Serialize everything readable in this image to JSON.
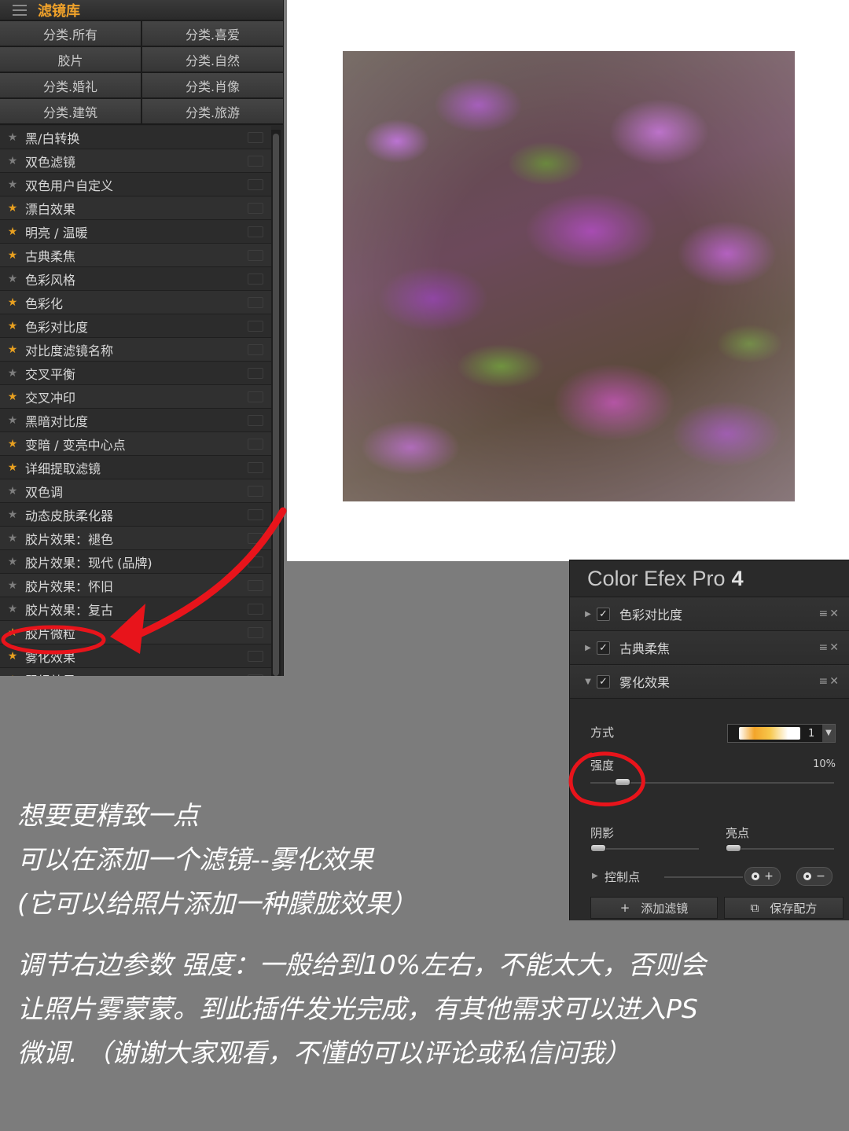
{
  "library": {
    "title": "滤镜库",
    "categories": [
      "分类.所有",
      "分类.喜爱",
      "胶片",
      "分类.自然",
      "分类.婚礼",
      "分类.肖像",
      "分类.建筑",
      "分类.旅游"
    ],
    "filters": [
      {
        "name": "黑/白转换",
        "favorite": false
      },
      {
        "name": "双色滤镜",
        "favorite": false
      },
      {
        "name": "双色用户自定义",
        "favorite": false
      },
      {
        "name": "漂白效果",
        "favorite": true
      },
      {
        "name": "明亮 / 温暖",
        "favorite": true
      },
      {
        "name": "古典柔焦",
        "favorite": true
      },
      {
        "name": "色彩风格",
        "favorite": false
      },
      {
        "name": "色彩化",
        "favorite": true
      },
      {
        "name": "色彩对比度",
        "favorite": true
      },
      {
        "name": "对比度滤镜名称",
        "favorite": true
      },
      {
        "name": "交叉平衡",
        "favorite": false
      },
      {
        "name": "交叉冲印",
        "favorite": true
      },
      {
        "name": "黑暗对比度",
        "favorite": false
      },
      {
        "name": "变暗 / 变亮中心点",
        "favorite": true
      },
      {
        "name": "详细提取滤镜",
        "favorite": true
      },
      {
        "name": "双色调",
        "favorite": false
      },
      {
        "name": "动态皮肤柔化器",
        "favorite": false
      },
      {
        "name": "胶片效果：褪色",
        "favorite": false
      },
      {
        "name": "胶片效果：现代 (品牌)",
        "favorite": false
      },
      {
        "name": "胶片效果：怀旧",
        "favorite": false
      },
      {
        "name": "胶片效果：复古",
        "favorite": false
      },
      {
        "name": "胶片微粒",
        "favorite": true
      },
      {
        "name": "雾化效果",
        "favorite": true
      },
      {
        "name": "翠绿效果",
        "favorite": true
      }
    ]
  },
  "efex": {
    "title": "Color Efex Pro",
    "version": "4",
    "filters": [
      {
        "label": "色彩对比度",
        "checked": "✓",
        "expanded": false
      },
      {
        "label": "古典柔焦",
        "checked": "✓",
        "expanded": false
      },
      {
        "label": "雾化效果",
        "checked": "✓",
        "expanded": true
      }
    ],
    "params": {
      "method_label": "方式",
      "method_value": "1",
      "strength_label": "强度",
      "strength_value": "10%",
      "strength_fraction": 0.1,
      "shadow_label": "阴影",
      "highlight_label": "亮点",
      "control_points_label": "控制点"
    },
    "add_filter_label": "添加滤镜",
    "save_recipe_label": "保存配方"
  },
  "captions": {
    "lines1": [
      "想要更精致一点",
      "可以在添加一个滤镜--雾化效果",
      "(它可以给照片添加一种朦胧效果）"
    ],
    "lines2": [
      "调节右边参数  强度：一般给到10%左右，不能太大，否则会",
      "让照片雾蒙蒙。到此插件发光完成，有其他需求可以进入PS",
      "微调. （谢谢大家观看，不懂的可以评论或私信问我）"
    ]
  },
  "colors": {
    "accent": "#f0a22a",
    "annotation": "#e8141b"
  }
}
